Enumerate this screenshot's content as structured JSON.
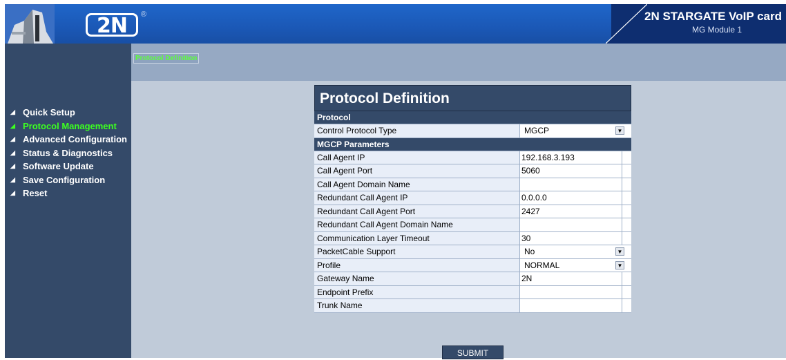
{
  "header": {
    "logo_text": "2N",
    "registered_mark": "®",
    "product_title": "2N STARGATE VoIP card",
    "product_subtitle": "MG Module 1"
  },
  "sidebar": {
    "items": [
      {
        "label": "Quick Setup",
        "active": false
      },
      {
        "label": "Protocol Management",
        "active": true
      },
      {
        "label": "Advanced Configuration",
        "active": false
      },
      {
        "label": "Status & Diagnostics",
        "active": false
      },
      {
        "label": "Software Update",
        "active": false
      },
      {
        "label": "Save Configuration",
        "active": false
      },
      {
        "label": "Reset",
        "active": false
      }
    ]
  },
  "breadcrumb": "Protocol Definition",
  "panel": {
    "title": "Protocol Definition",
    "sections": [
      {
        "header": "Protocol",
        "rows": [
          {
            "label": "Control Protocol Type",
            "value": "MGCP",
            "type": "select"
          }
        ]
      },
      {
        "header": "MGCP Parameters",
        "rows": [
          {
            "label": "Call Agent IP",
            "value": "192.168.3.193",
            "type": "text"
          },
          {
            "label": "Call Agent Port",
            "value": "5060",
            "type": "text"
          },
          {
            "label": "Call Agent Domain Name",
            "value": "",
            "type": "text"
          },
          {
            "label": "Redundant Call Agent IP",
            "value": "0.0.0.0",
            "type": "text"
          },
          {
            "label": "Redundant Call Agent Port",
            "value": "2427",
            "type": "text"
          },
          {
            "label": "Redundant Call Agent Domain Name",
            "value": "",
            "type": "text"
          },
          {
            "label": "Communication Layer Timeout",
            "value": "30",
            "type": "text"
          },
          {
            "label": "PacketCable Support",
            "value": "No",
            "type": "select"
          },
          {
            "label": "Profile",
            "value": "NORMAL",
            "type": "select"
          },
          {
            "label": "Gateway Name",
            "value": "2N",
            "type": "text"
          },
          {
            "label": "Endpoint Prefix",
            "value": "",
            "type": "text"
          },
          {
            "label": "Trunk Name",
            "value": "",
            "type": "text"
          }
        ]
      }
    ]
  },
  "submit_label": "SUBMIT",
  "colors": {
    "header_blue": "#1b58b6",
    "sidebar_bg": "#344a69",
    "active_green": "#3cff20",
    "content_bg": "#c0cbd9"
  },
  "icons": {
    "nav_bullet": "arrow-bullet-icon",
    "select": "chevron-down-icon"
  }
}
